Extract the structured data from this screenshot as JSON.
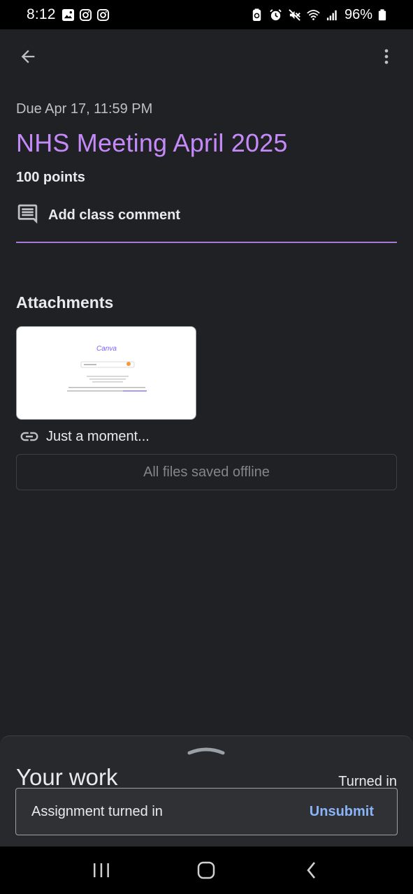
{
  "status_bar": {
    "time": "8:12",
    "battery": "96%"
  },
  "assignment": {
    "due": "Due Apr 17, 11:59 PM",
    "title": "NHS Meeting April 2025",
    "points": "100 points",
    "comment_label": "Add class comment"
  },
  "attachments": {
    "heading": "Attachments",
    "items": [
      {
        "thumbnail_text": "Canva",
        "link_text": "Just a moment..."
      }
    ],
    "offline_label": "All files saved offline"
  },
  "your_work": {
    "label": "Your work",
    "status": "Turned in"
  },
  "snackbar": {
    "message": "Assignment turned in",
    "action": "Unsubmit"
  },
  "colors": {
    "accent_title": "#c58af9",
    "link_action": "#8ab4f8",
    "background": "#202124"
  },
  "icons": {
    "back": "arrow-back-icon",
    "more": "more-vert-icon",
    "comment": "comment-icon",
    "link": "link-icon"
  }
}
